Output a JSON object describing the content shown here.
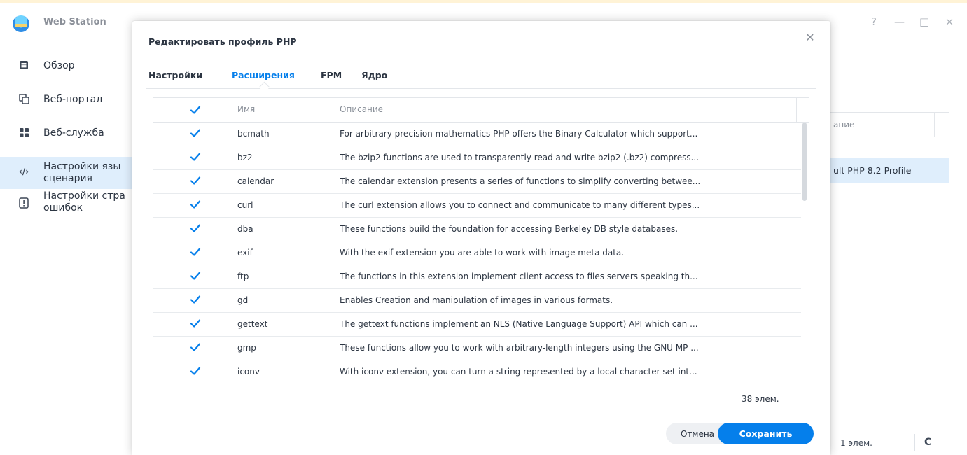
{
  "app": {
    "title": "Web Station"
  },
  "window_controls": [
    "?",
    "—",
    "□",
    "×"
  ],
  "sidebar": {
    "items": [
      {
        "label": "Обзор",
        "icon": "overview-icon"
      },
      {
        "label": "Веб-портал",
        "icon": "portal-icon"
      },
      {
        "label": "Веб-служба",
        "icon": "service-icon"
      },
      {
        "label": "Настройки язы\nсценария",
        "icon": "script-icon",
        "active": true
      },
      {
        "label": "Настройки стра\nошибок",
        "icon": "error-page-icon"
      }
    ]
  },
  "background_table": {
    "header": "ание",
    "row": "ult PHP 8.2 Profile",
    "footer_count": "1 элем."
  },
  "dialog": {
    "title": "Редактировать профиль PHP",
    "tabs": [
      {
        "label": "Настройки"
      },
      {
        "label": "Расширения",
        "active": true
      },
      {
        "label": "FPM"
      },
      {
        "label": "Ядро"
      }
    ],
    "columns": {
      "name": "Имя",
      "description": "Описание"
    },
    "extensions": [
      {
        "name": "bcmath",
        "description": "For arbitrary precision mathematics PHP offers the Binary Calculator which support...",
        "checked": true
      },
      {
        "name": "bz2",
        "description": "The bzip2 functions are used to transparently read and write bzip2 (.bz2) compress...",
        "checked": true
      },
      {
        "name": "calendar",
        "description": "The calendar extension presents a series of functions to simplify converting betwee...",
        "checked": true
      },
      {
        "name": "curl",
        "description": "The curl extension allows you to connect and communicate to many different types...",
        "checked": true
      },
      {
        "name": "dba",
        "description": "These functions build the foundation for accessing Berkeley DB style databases.",
        "checked": true
      },
      {
        "name": "exif",
        "description": "With the exif extension you are able to work with image meta data.",
        "checked": true
      },
      {
        "name": "ftp",
        "description": "The functions in this extension implement client access to files servers speaking th...",
        "checked": true
      },
      {
        "name": "gd",
        "description": "Enables Creation and manipulation of images in various formats.",
        "checked": true
      },
      {
        "name": "gettext",
        "description": "The gettext functions implement an NLS (Native Language Support) API which can ...",
        "checked": true
      },
      {
        "name": "gmp",
        "description": "These functions allow you to work with arbitrary-length integers using the GNU MP ...",
        "checked": true
      },
      {
        "name": "iconv",
        "description": "With iconv extension, you can turn a string represented by a local character set int...",
        "checked": true
      }
    ],
    "count": "38 элем.",
    "buttons": {
      "cancel": "Отмена",
      "save": "Сохранить"
    }
  },
  "colors": {
    "accent": "#057feb",
    "active_bg": "#dfeefc",
    "check": "#057feb"
  }
}
